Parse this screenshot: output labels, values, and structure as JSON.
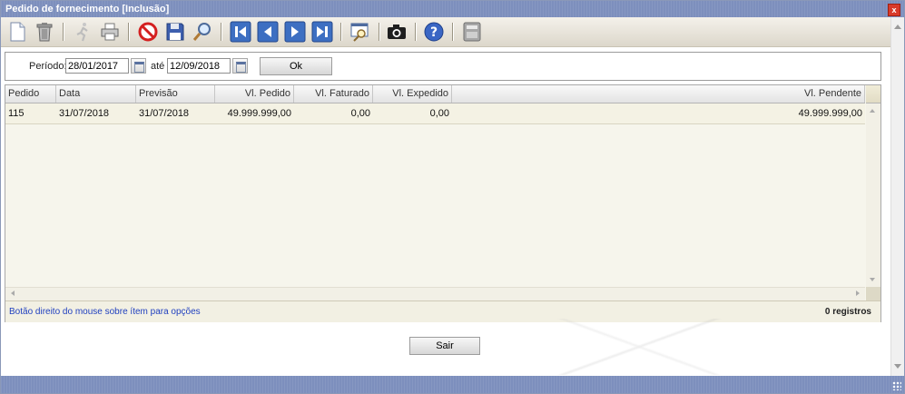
{
  "window": {
    "title": "Pedido de fornecimento [Inclusão]",
    "close_label": "x"
  },
  "toolbar": {
    "buttons": [
      {
        "name": "new-document-icon"
      },
      {
        "name": "trash-icon"
      },
      {
        "name": "run-icon"
      },
      {
        "name": "printer-icon"
      },
      {
        "name": "cancel-icon"
      },
      {
        "name": "save-icon"
      },
      {
        "name": "search-icon"
      },
      {
        "name": "first-record-icon"
      },
      {
        "name": "previous-record-icon"
      },
      {
        "name": "next-record-icon"
      },
      {
        "name": "last-record-icon"
      },
      {
        "name": "preview-icon"
      },
      {
        "name": "camera-icon"
      },
      {
        "name": "help-icon"
      },
      {
        "name": "calculator-icon"
      }
    ]
  },
  "filter": {
    "period_label": "Período:",
    "date_from": "28/01/2017",
    "to_label": "até",
    "date_to": "12/09/2018",
    "ok_label": "Ok"
  },
  "grid": {
    "columns": [
      "Pedido",
      "Data",
      "Previsão",
      "Vl. Pedido",
      "Vl. Faturado",
      "Vl. Expedido",
      "Vl. Pendente"
    ],
    "rows": [
      [
        "115",
        "31/07/2018",
        "31/07/2018",
        "49.999.999,00",
        "0,00",
        "0,00",
        "49.999.999,00"
      ]
    ],
    "hint": "Botão direito do mouse sobre ítem para opções",
    "count": "0 registros"
  },
  "footer": {
    "exit_label": "Sair"
  },
  "colors": {
    "titlebar": "#7d8fbd",
    "hint": "#1f3fbf",
    "cancel": "#d42020",
    "nav": "#3d6fc2"
  }
}
